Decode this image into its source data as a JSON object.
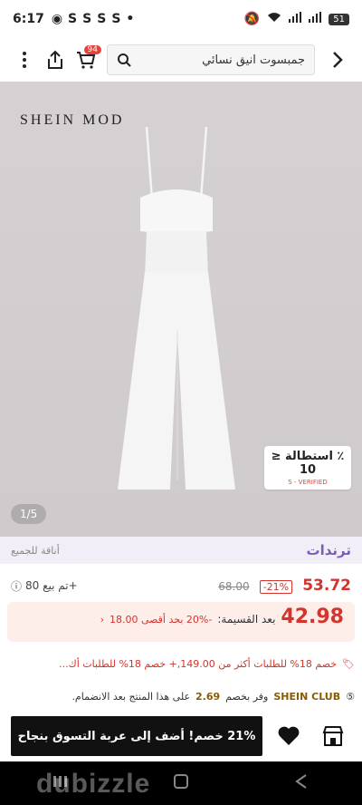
{
  "status_bar": {
    "time": "6:17",
    "notifications": [
      "S",
      "S",
      "S",
      "S"
    ],
    "battery": "51"
  },
  "header": {
    "cart_count": "94",
    "search_text": "جمبسوت انيق نسائي"
  },
  "hero": {
    "brand": "SHEIN MOD",
    "image_counter": "1/5",
    "stretch_label": "٪ استطالة ≤ 10",
    "verified_label": "S - VERIFIED"
  },
  "tags": {
    "trend": "ترندات",
    "elegance": "أناقة للجميع"
  },
  "price": {
    "current": "53.72",
    "discount": "-21%",
    "original": "68.00",
    "sold": "تم بيع 80+"
  },
  "coupon": {
    "price": "42.98",
    "after_label": "بعد القسيمة:",
    "percent": "-20% بحد أقصى 18.00",
    "detail": "خصم 18% للطلبات أكثر من 149.00,+ خصم 18% للطلبات أك..."
  },
  "club": {
    "name": "SHEIN CLUB",
    "text": "وفر بخصم",
    "amount": "2.69",
    "suffix": "على هذا المنتج بعد الانضمام."
  },
  "bottom": {
    "add_to_cart": "21% خصم! أضف إلى عربة التسوق بنجاح"
  },
  "watermark": "dubizzle",
  "colors": {
    "accent_red": "#d6332c",
    "trend_purple": "#7b5db5",
    "club_gold": "#8a5a00"
  }
}
